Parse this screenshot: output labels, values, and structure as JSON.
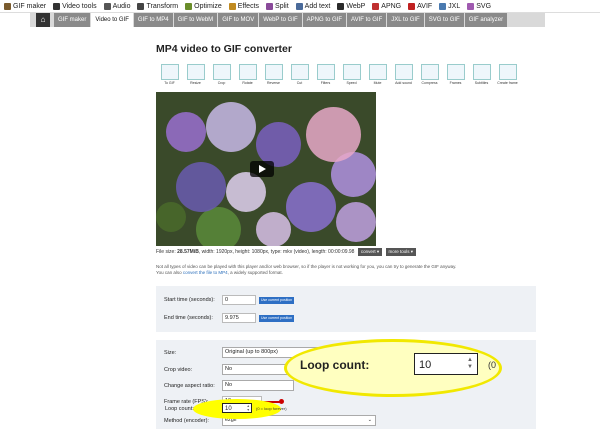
{
  "topnav": {
    "items": [
      {
        "label": "GIF maker",
        "icon": "gif-maker-icon",
        "color": "#7a5b2e"
      },
      {
        "label": "Video tools",
        "icon": "video-tools-icon",
        "color": "#333333"
      },
      {
        "label": "Audio",
        "icon": "audio-icon",
        "color": "#555555"
      },
      {
        "label": "Transform",
        "icon": "transform-icon",
        "color": "#444444"
      },
      {
        "label": "Optimize",
        "icon": "optimize-icon",
        "color": "#6a8d2a"
      },
      {
        "label": "Effects",
        "icon": "effects-icon",
        "color": "#c08a20"
      },
      {
        "label": "Split",
        "icon": "split-icon",
        "color": "#8a4a9a"
      },
      {
        "label": "Add text",
        "icon": "add-text-icon",
        "color": "#4a6a9a"
      },
      {
        "label": "WebP",
        "icon": "webp-icon",
        "color": "#2a2a2a"
      },
      {
        "label": "APNG",
        "icon": "apng-icon",
        "color": "#c03030"
      },
      {
        "label": "AVIF",
        "icon": "avif-icon",
        "color": "#c02020"
      },
      {
        "label": "JXL",
        "icon": "jxl-icon",
        "color": "#4a7ab0"
      },
      {
        "label": "SVG",
        "icon": "svg-icon",
        "color": "#a05ab0"
      }
    ]
  },
  "tabs": {
    "items": [
      "GIF maker",
      "Video to GIF",
      "GIF to MP4",
      "GIF to WebM",
      "GIF to MOV",
      "WebP to GIF",
      "APNG to GIF",
      "AVIF to GIF",
      "JXL to GIF",
      "SVG to GIF",
      "GIF analyzer"
    ],
    "active_index": 1
  },
  "page": {
    "title": "MP4 video to GIF converter"
  },
  "tools": [
    {
      "label": "To GIF",
      "icon": "clapperboard-icon"
    },
    {
      "label": "Resize",
      "icon": "resize-icon"
    },
    {
      "label": "Crop",
      "icon": "crop-icon"
    },
    {
      "label": "Rotate",
      "icon": "rotate-icon"
    },
    {
      "label": "Reverse",
      "icon": "reverse-icon"
    },
    {
      "label": "Cut",
      "icon": "scissors-icon"
    },
    {
      "label": "Filters",
      "icon": "filters-icon"
    },
    {
      "label": "Speed",
      "icon": "speed-icon"
    },
    {
      "label": "Mute",
      "icon": "mute-icon"
    },
    {
      "label": "Add sound",
      "icon": "add-sound-icon"
    },
    {
      "label": "Compress",
      "icon": "compress-icon"
    },
    {
      "label": "Frames",
      "icon": "frames-icon"
    },
    {
      "label": "Subtitles",
      "icon": "subtitles-icon"
    },
    {
      "label": "Create frame",
      "icon": "create-frame-icon"
    }
  ],
  "video": {
    "play_icon": "play-icon"
  },
  "fileinfo": {
    "prefix": "File size:",
    "size": "28.57MiB",
    "details": ", width: 1920px, height: 1080px, type: mkv (video), length: 00:00:09.98",
    "convert_label": "convert ▾",
    "more_label": "more tools ▾"
  },
  "note": {
    "line1": "Not all types of video can be played with this player and/or web browser, so if the player is not working for you, you can try to generate the GIF anyway.",
    "line2_prefix": "You can also",
    "line2_link": "convert the file to MP4",
    "line2_suffix": ", a widely supported format."
  },
  "times": {
    "start_label": "Start time (seconds):",
    "start_value": "0",
    "end_label": "End time (seconds):",
    "end_value": "9.975",
    "use_current_label": "Use current position"
  },
  "options": {
    "size_label": "Size:",
    "size_value": "Original (up to 800px)",
    "crop_label": "Crop video:",
    "crop_value": "No",
    "aspect_label": "Change aspect ratio:",
    "aspect_value": "No",
    "fps_label": "Frame rate (FPS):",
    "fps_value": "10",
    "method_label": "Method (encoder):",
    "method_value": "ezgif",
    "loop_label": "Loop count:",
    "loop_value": "10",
    "loop_hint": "(0 = loop forever)"
  },
  "callout": {
    "label": "Loop count:",
    "value": "10",
    "tail": "(0"
  },
  "colors": {
    "highlight": "#ffff00",
    "accent_blue": "#2e6fc4",
    "slider_red": "#cc0000"
  }
}
